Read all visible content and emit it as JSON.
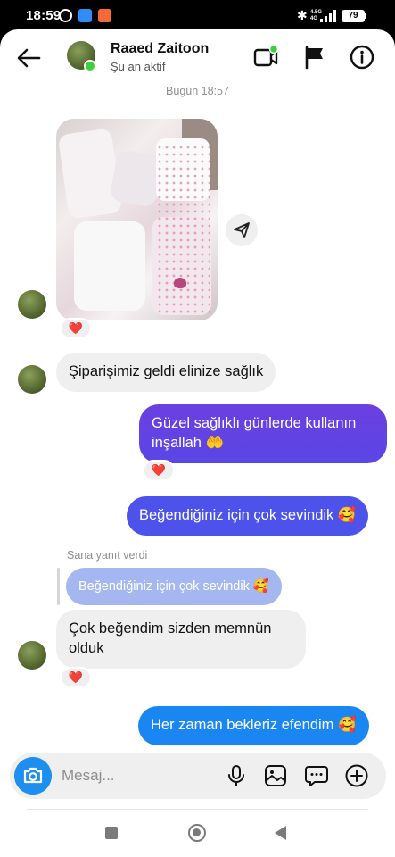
{
  "status_bar": {
    "time": "18:59",
    "network_label": "4.5G",
    "network_sub": "4G",
    "battery": "79"
  },
  "header": {
    "contact_name": "Raaed Zaitoon",
    "presence": "Şu an aktif"
  },
  "conversation": {
    "timestamp": "Bugün 18:57",
    "messages": [
      {
        "id": "m1",
        "direction": "in",
        "type": "photo",
        "reaction": "❤️"
      },
      {
        "id": "m2",
        "direction": "in",
        "text": "Şiparişimiz geldi elinize sağlık"
      },
      {
        "id": "m3",
        "direction": "out",
        "text": "Güzel sağlıklı günlerde kullanın inşallah 🤲",
        "reaction": "❤️"
      },
      {
        "id": "m4",
        "direction": "out",
        "text": "Beğendiğiniz için çok sevindik 🥰"
      },
      {
        "id": "m5",
        "direction": "in",
        "reply_label": "Sana yanıt verdi",
        "quoted_text": "Beğendiğiniz için çok sevindik 🥰",
        "text": "Çok beğendim sizden memnün olduk",
        "reaction": "❤️"
      },
      {
        "id": "m6",
        "direction": "out",
        "text": "Her zaman bekleriz efendim 🥰"
      }
    ]
  },
  "composer": {
    "placeholder": "Mesaj..."
  },
  "icons": {
    "back": "arrow-left-icon",
    "video": "video-call-icon",
    "flag": "flag-icon",
    "info": "info-icon",
    "share": "paper-plane-icon",
    "camera": "camera-icon",
    "mic": "microphone-icon",
    "gallery": "gallery-icon",
    "sticker": "sticker-icon",
    "add": "plus-circle-icon"
  },
  "colors": {
    "outgoing_gradient_top": "#6c3fe0",
    "outgoing_gradient_mid": "#3d5cf0",
    "outgoing_gradient_bottom": "#1a86f2",
    "incoming_bubble": "#efefef",
    "online": "#3ecf3e",
    "camera_button": "#1e8fef",
    "reply_bubble": "#a5b7f0"
  }
}
